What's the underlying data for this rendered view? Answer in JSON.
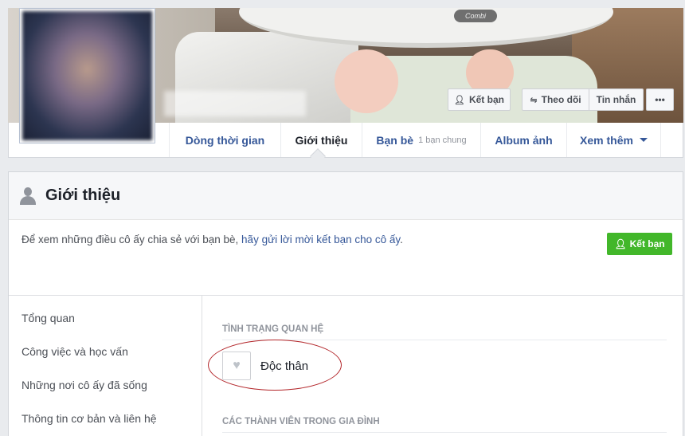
{
  "cover": {
    "brand_text": "Combi"
  },
  "cover_actions": {
    "add_friend": "Kết bạn",
    "follow": "Theo dõi",
    "message": "Tin nhắn",
    "more": "•••"
  },
  "nav": {
    "tabs": [
      {
        "label": "Dòng thời gian"
      },
      {
        "label": "Giới thiệu",
        "active": true
      },
      {
        "label": "Bạn bè",
        "sub": "1 bạn chung"
      },
      {
        "label": "Album ảnh"
      },
      {
        "label": "Xem thêm"
      }
    ]
  },
  "about": {
    "title": "Giới thiệu",
    "invite_prefix": "Để xem những điều cô ấy chia sẻ với bạn bè, ",
    "invite_link": "hãy gửi lời mời kết bạn cho cô ấy",
    "invite_suffix": ".",
    "add_friend_button": "Kết bạn"
  },
  "sidebar": {
    "items": [
      {
        "label": "Tổng quan"
      },
      {
        "label": "Công việc và học vấn"
      },
      {
        "label": "Những nơi cô ấy đã sống"
      },
      {
        "label": "Thông tin cơ bản và liên hệ"
      }
    ]
  },
  "relationship": {
    "section_title": "TÌNH TRẠNG QUAN HỆ",
    "status": "Độc thân",
    "icon": "heart-icon"
  },
  "family": {
    "section_title": "CÁC THÀNH VIÊN TRONG GIA ĐÌNH"
  },
  "colors": {
    "link": "#365899",
    "primary_green": "#42b72a",
    "annotation_red": "#b3262a"
  }
}
